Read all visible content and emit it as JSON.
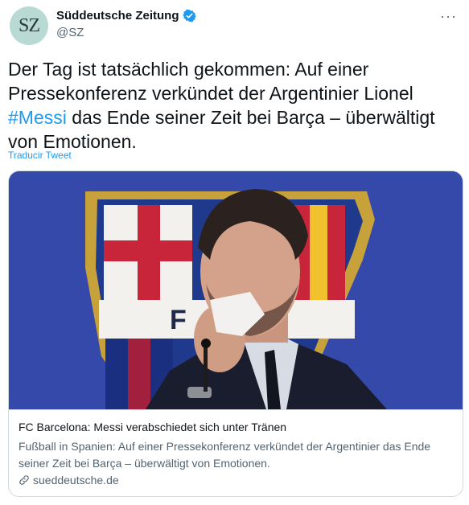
{
  "author": {
    "avatar_text": "SZ",
    "display_name": "Süddeutsche Zeitung",
    "handle": "@SZ",
    "verified": true
  },
  "tweet": {
    "text_before": "Der Tag ist tatsächlich gekommen: Auf einer Pressekonferenz verkündet der Argentinier Lionel ",
    "hashtag": "#Messi",
    "text_after": " das Ende seiner Zeit bei Barça – überwältigt von Emotionen.",
    "translate_label": "Traducir Tweet"
  },
  "card": {
    "title": "FC Barcelona: Messi verabschiedet sich unter Tränen",
    "description": "Fußball in Spanien: Auf einer Pressekonferenz verkündet der Argentinier das Ende seiner Zeit bei Barça – überwältigt von Emotionen.",
    "domain": "sueddeutsche.de"
  },
  "icons": {
    "verified": "verified-badge-icon",
    "more": "more-options-icon",
    "link": "link-icon"
  },
  "colors": {
    "accent": "#1d9bf0",
    "secondary_text": "#536471",
    "image_background": "#3a4fb0"
  }
}
